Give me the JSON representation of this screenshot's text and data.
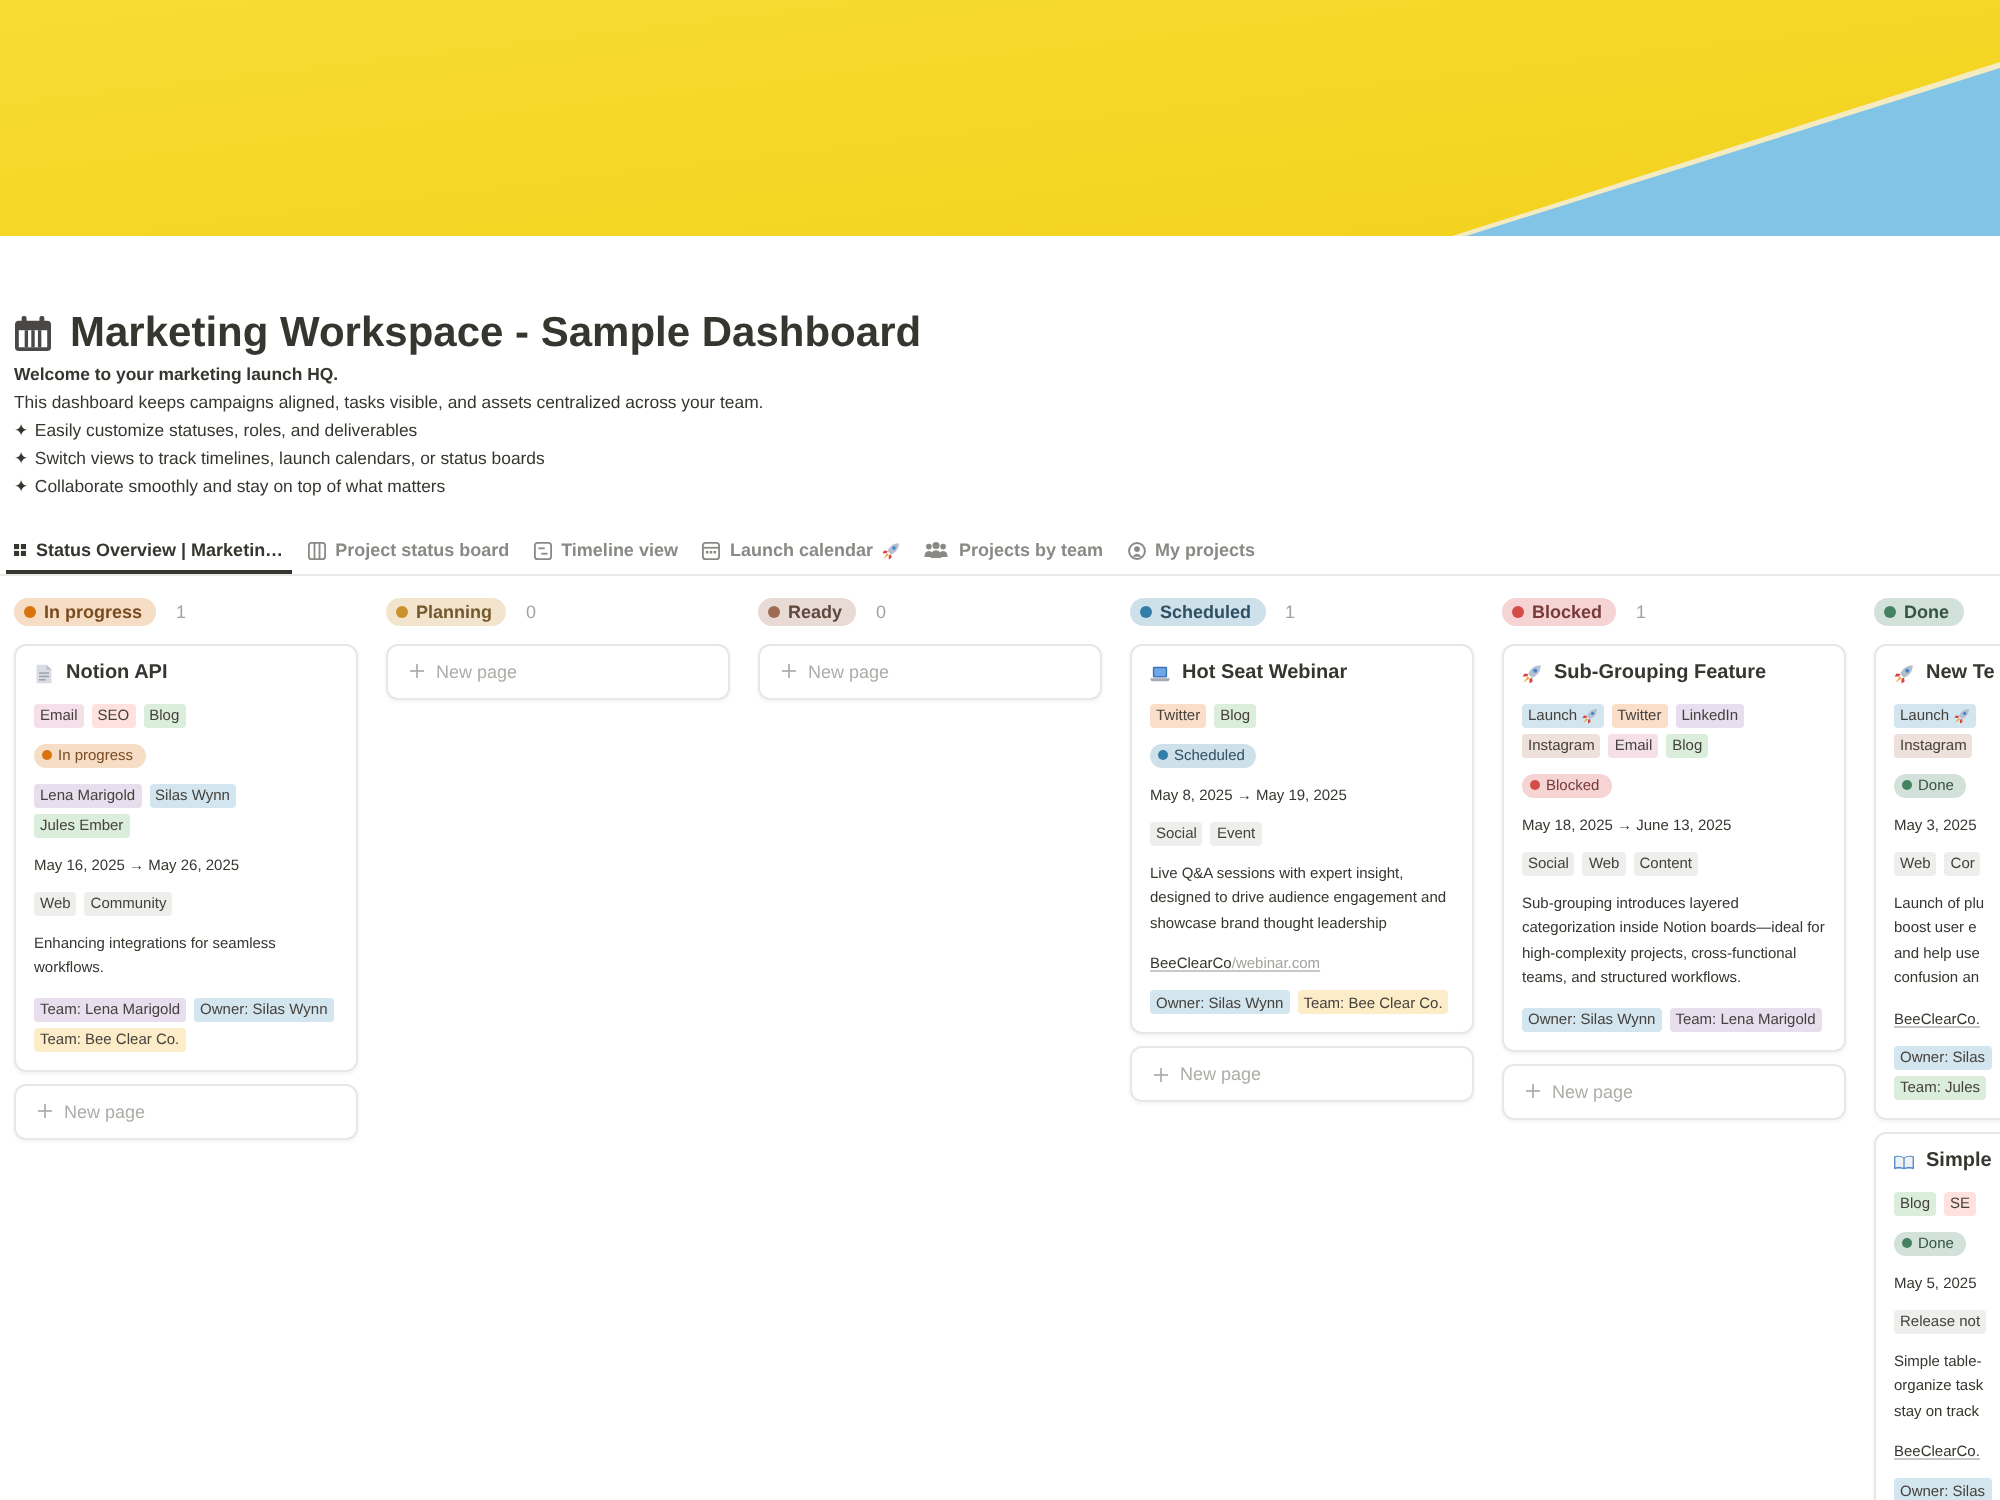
{
  "page": {
    "title": "Marketing Workspace - Sample Dashboard",
    "intro_heading": "Welcome to your marketing launch HQ.",
    "intro_lines": [
      "This dashboard keeps campaigns aligned, tasks visible, and assets centralized across your team.",
      "✦ Easily customize statuses, roles, and deliverables",
      "✦ Switch views to track timelines, launch calendars, or status boards",
      "✦ Collaborate smoothly and stay on top of what matters"
    ]
  },
  "tabs": [
    {
      "label": "Status Overview | Marketin…",
      "kind": "table",
      "selected": true,
      "trailing_emoji": false
    },
    {
      "label": "Project status board",
      "kind": "board",
      "selected": false,
      "trailing_emoji": false
    },
    {
      "label": "Timeline view",
      "kind": "timeline",
      "selected": false,
      "trailing_emoji": false
    },
    {
      "label": "Launch calendar",
      "kind": "calendar",
      "selected": false,
      "trailing_emoji": true
    },
    {
      "label": "Projects by team",
      "kind": "team",
      "selected": false,
      "trailing_emoji": false
    },
    {
      "label": "My projects",
      "kind": "user",
      "selected": false,
      "trailing_emoji": false
    }
  ],
  "board": {
    "columns": [
      {
        "name": "In progress",
        "color": "#d9730d",
        "count": "1",
        "cards": [
          {
            "kind": "doc",
            "title": "Notion API",
            "tags": [
              {
                "label": "Email",
                "color": "#f5e0e9",
                "trailing_emoji": false
              },
              {
                "label": "SEO",
                "color": "#ffe2dd",
                "trailing_emoji": false
              },
              {
                "label": "Blog",
                "color": "#dbeddb",
                "trailing_emoji": false
              }
            ],
            "status": {
              "label": "In progress",
              "color": "#d9730d"
            },
            "people": [
              {
                "label": "Lena Marigold",
                "color": "#e8deee"
              },
              {
                "label": "Silas Wynn",
                "color": "#d3e5ef"
              },
              {
                "label": "Jules Ember",
                "color": "#dbeddb"
              }
            ],
            "dates": "May 16, 2025 → May 26, 2025",
            "categories": [
              "Web",
              "Community"
            ],
            "description": "Enhancing integrations for seamless workflows.",
            "owners": [
              {
                "label": "Team: Lena Marigold",
                "color": "#e8deee"
              },
              {
                "label": "Owner: Silas Wynn",
                "color": "#d3e5ef"
              },
              {
                "label": "Team: Bee Clear Co.",
                "color": "#fdecc8"
              }
            ]
          }
        ],
        "new_page": "New page"
      },
      {
        "name": "Planning",
        "color": "#cb912f",
        "count": "0",
        "new_page": "New page"
      },
      {
        "name": "Ready",
        "color": "#9f6b53",
        "count": "0",
        "new_page": "New page"
      },
      {
        "name": "Scheduled",
        "color": "#337ea9",
        "count": "1",
        "cards": [
          {
            "kind": "laptop",
            "title": "Hot Seat Webinar",
            "tags": [
              {
                "label": "Twitter",
                "color": "#fadec9",
                "trailing_emoji": false
              },
              {
                "label": "Blog",
                "color": "#dbeddb",
                "trailing_emoji": false
              }
            ],
            "status": {
              "label": "Scheduled",
              "color": "#337ea9"
            },
            "dates": "May 8, 2025 → May 19, 2025",
            "categories": [
              "Social",
              "Event"
            ],
            "description": "Live Q&A sessions with expert insight, designed to drive audience engagement and showcase brand thought leadership",
            "link": {
              "host": "BeeClearCo",
              "path": "/webinar.com"
            },
            "owners": [
              {
                "label": "Owner: Silas Wynn",
                "color": "#d3e5ef"
              },
              {
                "label": "Team: Bee Clear Co.",
                "color": "#fdecc8"
              }
            ]
          }
        ],
        "new_page": "New page"
      },
      {
        "name": "Blocked",
        "color": "#d44c47",
        "count": "1",
        "cards": [
          {
            "kind": "rocket",
            "title": "Sub-Grouping Feature",
            "tags": [
              {
                "label": "Launch",
                "color": "#d3e5ef",
                "trailing_emoji": true
              },
              {
                "label": "Twitter",
                "color": "#fadec9",
                "trailing_emoji": false
              },
              {
                "label": "LinkedIn",
                "color": "#e8deee",
                "trailing_emoji": false
              },
              {
                "label": "Instagram",
                "color": "#eee0da",
                "trailing_emoji": false
              },
              {
                "label": "Email",
                "color": "#f5e0e9",
                "trailing_emoji": false
              },
              {
                "label": "Blog",
                "color": "#dbeddb",
                "trailing_emoji": false
              }
            ],
            "status": {
              "label": "Blocked",
              "color": "#d44c47"
            },
            "dates": "May 18, 2025 → June 13, 2025",
            "categories": [
              "Social",
              "Web",
              "Content"
            ],
            "description": "Sub-grouping introduces layered categorization inside Notion boards—ideal for high-complexity projects, cross-functional teams, and structured workflows.",
            "owners": [
              {
                "label": "Owner: Silas Wynn",
                "color": "#d3e5ef"
              },
              {
                "label": "Team: Lena Marigold",
                "color": "#e8deee"
              }
            ]
          }
        ],
        "new_page": "New page"
      },
      {
        "name": "Done",
        "color": "#448361",
        "cards": [
          {
            "kind": "rocket",
            "title": "New Te",
            "tags": [
              {
                "label": "Launch",
                "color": "#d3e5ef",
                "trailing_emoji": true
              },
              {
                "label": "Instagram",
                "color": "#eee0da",
                "trailing_emoji": false
              }
            ],
            "status": {
              "label": "Done",
              "color": "#448361"
            },
            "dates": "May 3, 2025",
            "categories": [
              "Web",
              "Cor"
            ],
            "description": "Launch of plu\nboost user e\nand help use\nconfusion an",
            "link": {
              "host": "BeeClearCo."
            },
            "owners": [
              {
                "label": "Owner: Silas",
                "color": "#d3e5ef"
              },
              {
                "label": "Team: Jules",
                "color": "#dbeddb"
              }
            ]
          },
          {
            "kind": "book",
            "title": "Simple",
            "tags": [
              {
                "label": "Blog",
                "color": "#dbeddb",
                "trailing_emoji": false
              },
              {
                "label": "SE",
                "color": "#ffe2dd",
                "trailing_emoji": false
              }
            ],
            "status": {
              "label": "Done",
              "color": "#448361"
            },
            "dates": "May 5, 2025",
            "categories": [
              "Release not"
            ],
            "description": "Simple table-\norganize task\nstay on track",
            "link": {
              "host": "BeeClearCo."
            },
            "owners": [
              {
                "label": "Owner: Silas",
                "color": "#d3e5ef"
              }
            ]
          }
        ]
      }
    ]
  }
}
